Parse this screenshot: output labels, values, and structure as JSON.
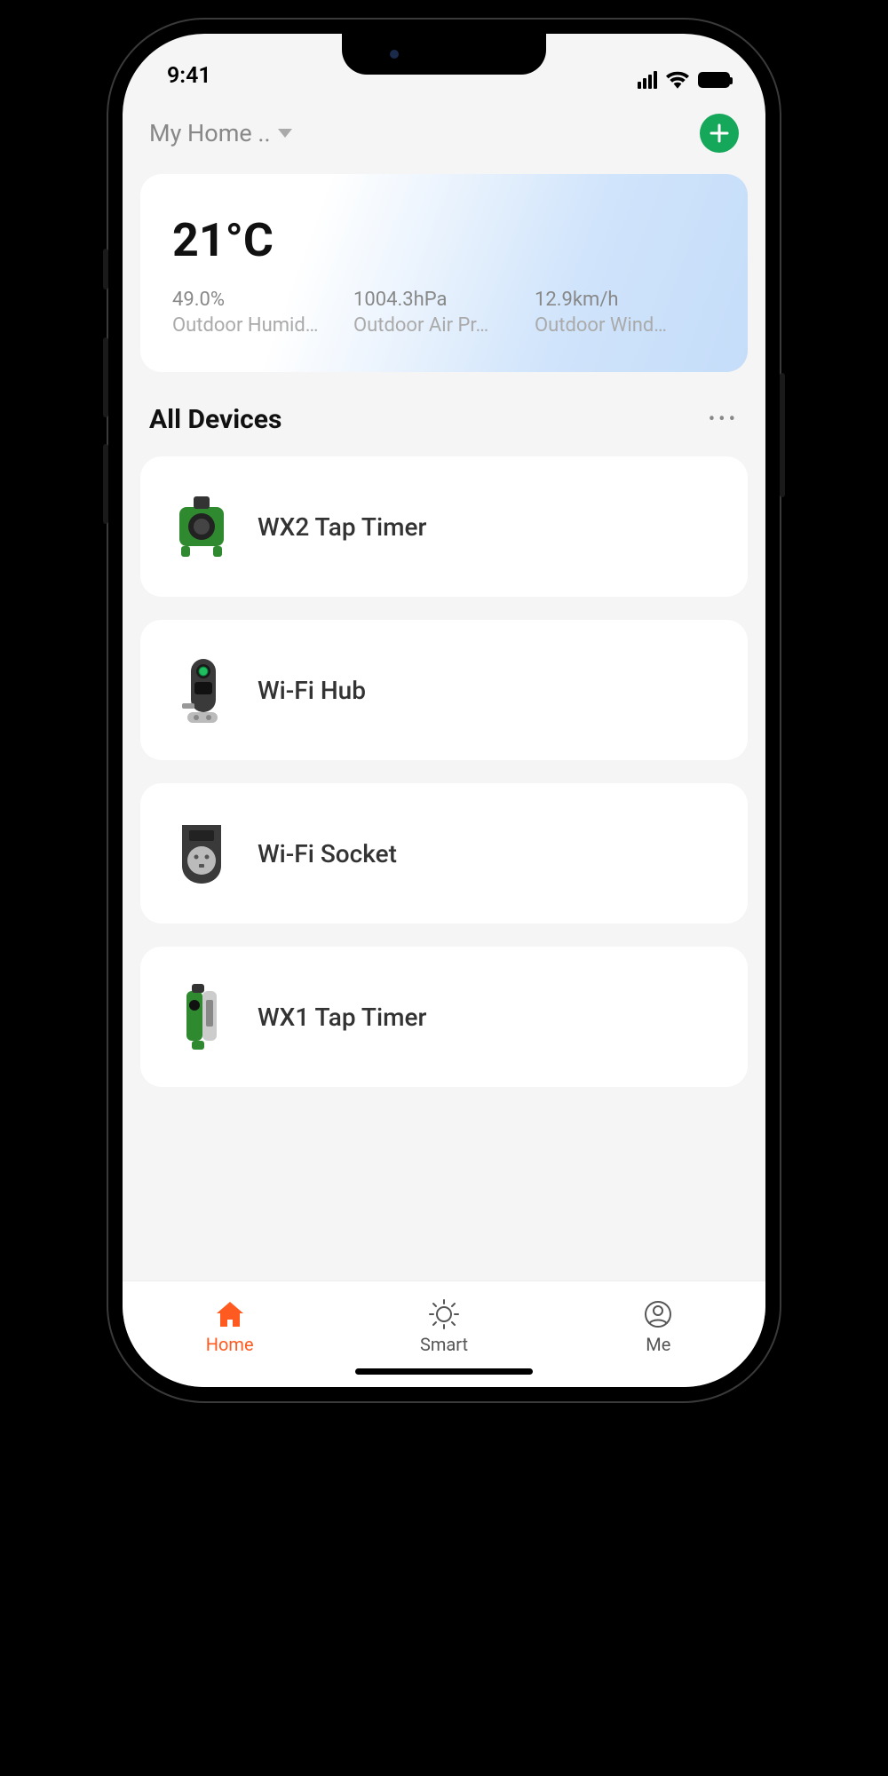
{
  "statusBar": {
    "time": "9:41"
  },
  "header": {
    "homeName": "My Home .."
  },
  "weather": {
    "temperature": "21°C",
    "stats": [
      {
        "value": "49.0%",
        "label": "Outdoor Humid…"
      },
      {
        "value": "1004.3hPa",
        "label": "Outdoor Air Pr…"
      },
      {
        "value": "12.9km/h",
        "label": "Outdoor Wind…"
      }
    ]
  },
  "section": {
    "title": "All Devices"
  },
  "devices": [
    {
      "name": "WX2 Tap Timer",
      "iconType": "tap-timer-2"
    },
    {
      "name": "Wi-Fi Hub",
      "iconType": "wifi-hub"
    },
    {
      "name": "Wi-Fi Socket",
      "iconType": "wifi-socket"
    },
    {
      "name": "WX1 Tap Timer",
      "iconType": "tap-timer-1"
    }
  ],
  "tabs": [
    {
      "label": "Home",
      "icon": "home",
      "active": true
    },
    {
      "label": "Smart",
      "icon": "sun",
      "active": false
    },
    {
      "label": "Me",
      "icon": "person",
      "active": false
    }
  ]
}
